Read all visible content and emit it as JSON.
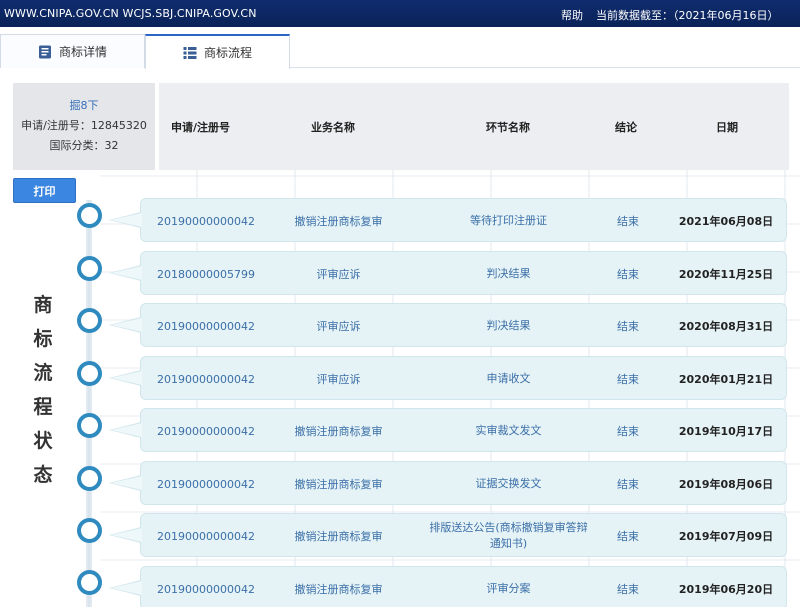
{
  "topbar": {
    "sites": "WWW.CNIPA.GOV.CN WCJS.SBJ.CNIPA.GOV.CN",
    "help": "帮助",
    "as_of": "当前数据截至：（2021年06月16日）"
  },
  "tabs": [
    {
      "label": "商标详情",
      "icon": "document-icon",
      "active": false
    },
    {
      "label": "商标流程",
      "icon": "list-icon",
      "active": true
    }
  ],
  "info": {
    "name": "掘8下",
    "reg_no": "申请/注册号：12845320",
    "intl_class": "国际分类：32"
  },
  "columns": [
    "申请/注册号",
    "业务名称",
    "环节名称",
    "结论",
    "日期"
  ],
  "print_label": "打印",
  "side_title": [
    "商",
    "标",
    "流",
    "程",
    "状",
    "态"
  ],
  "rows": [
    {
      "no": "20190000000042",
      "biz": "撤销注册商标复审",
      "step": "等待打印注册证",
      "result": "结束",
      "date": "2021年06月08日"
    },
    {
      "no": "20180000005799",
      "biz": "评审应诉",
      "step": "判决结果",
      "result": "结束",
      "date": "2020年11月25日"
    },
    {
      "no": "20190000000042",
      "biz": "评审应诉",
      "step": "判决结果",
      "result": "结束",
      "date": "2020年08月31日"
    },
    {
      "no": "20190000000042",
      "biz": "评审应诉",
      "step": "申请收文",
      "result": "结束",
      "date": "2020年01月21日"
    },
    {
      "no": "20190000000042",
      "biz": "撤销注册商标复审",
      "step": "实审裁文发文",
      "result": "结束",
      "date": "2019年10月17日"
    },
    {
      "no": "20190000000042",
      "biz": "撤销注册商标复审",
      "step": "证据交换发文",
      "result": "结束",
      "date": "2019年08月06日"
    },
    {
      "no": "20190000000042",
      "biz": "撤销注册商标复审",
      "step": "排版送达公告(商标撤销复审答辩通知书)",
      "result": "结束",
      "date": "2019年07月09日"
    },
    {
      "no": "20190000000042",
      "biz": "撤销注册商标复审",
      "step": "评审分案",
      "result": "结束",
      "date": "2019年06月20日"
    }
  ],
  "colors": {
    "topbar": "#0f2c6e",
    "accent": "#3b86e0",
    "dot": "#2f8bbf",
    "row_bg": "#e6f3f6"
  }
}
